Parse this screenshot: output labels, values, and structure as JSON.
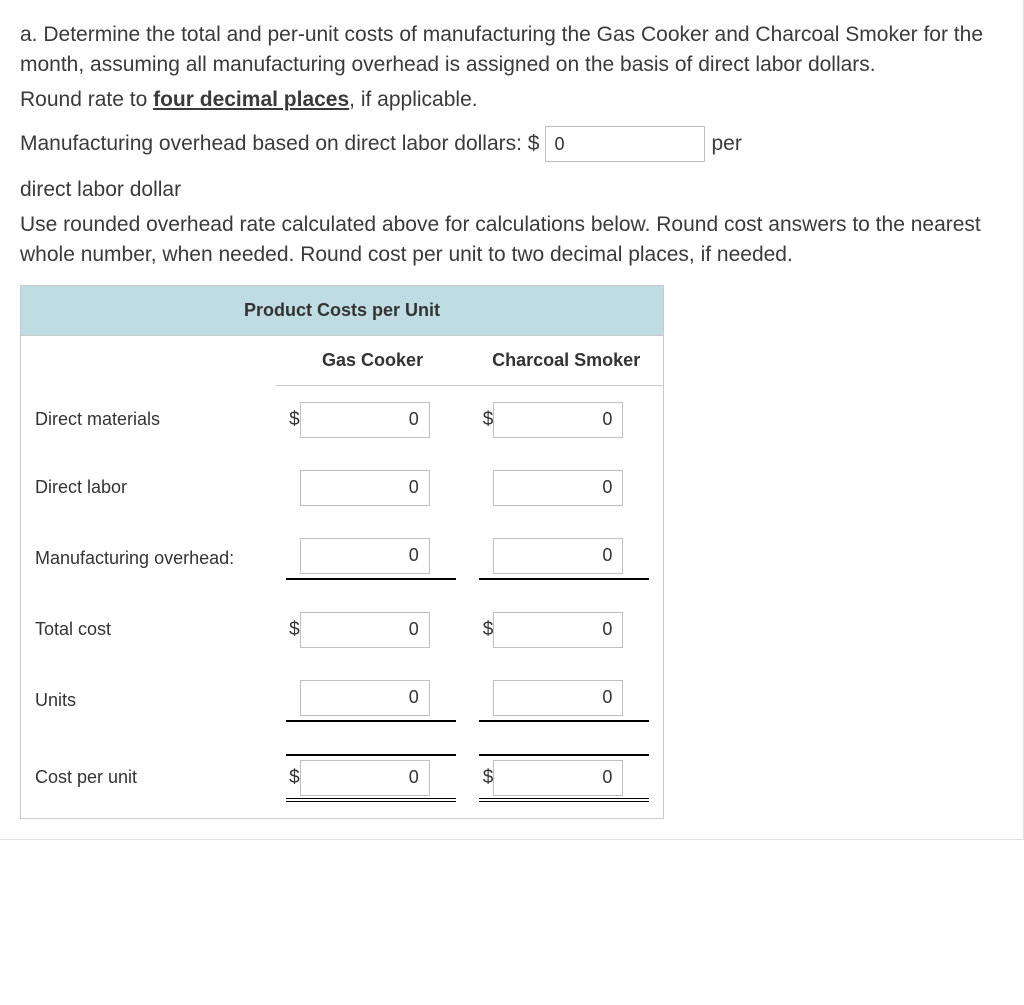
{
  "question": {
    "part_a_text": "a. Determine the total and per-unit costs of manufacturing the Gas Cooker and Charcoal Smoker for the month, assuming all manufacturing overhead is assigned on the basis of direct labor dollars.",
    "round_prefix": "Round rate to ",
    "round_emphasis": "four decimal places",
    "round_suffix": ", if applicable.",
    "overhead_label_prefix": "Manufacturing overhead based on direct labor dollars:  $",
    "overhead_value": "0",
    "overhead_label_suffix": "per",
    "direct_labor_dollar": "direct labor dollar",
    "instructions2": "Use rounded overhead rate calculated above for calculations below. Round cost answers to the nearest whole number, when needed. Round cost per unit to two decimal places, if needed."
  },
  "table": {
    "title": "Product Costs per Unit",
    "col1": "Gas Cooker",
    "col2": "Charcoal Smoker",
    "rows": {
      "direct_materials": {
        "label": "Direct materials",
        "gas": "0",
        "charcoal": "0",
        "dollar": "$"
      },
      "direct_labor": {
        "label": "Direct labor",
        "gas": "0",
        "charcoal": "0",
        "dollar": ""
      },
      "manufacturing_overhead": {
        "label": "Manufacturing overhead:",
        "gas": "0",
        "charcoal": "0",
        "dollar": ""
      },
      "total_cost": {
        "label": "Total cost",
        "gas": "0",
        "charcoal": "0",
        "dollar": "$"
      },
      "units": {
        "label": "Units",
        "gas": "0",
        "charcoal": "0",
        "dollar": ""
      },
      "cost_per_unit": {
        "label": "Cost per unit",
        "gas": "0",
        "charcoal": "0",
        "dollar": "$"
      }
    }
  }
}
